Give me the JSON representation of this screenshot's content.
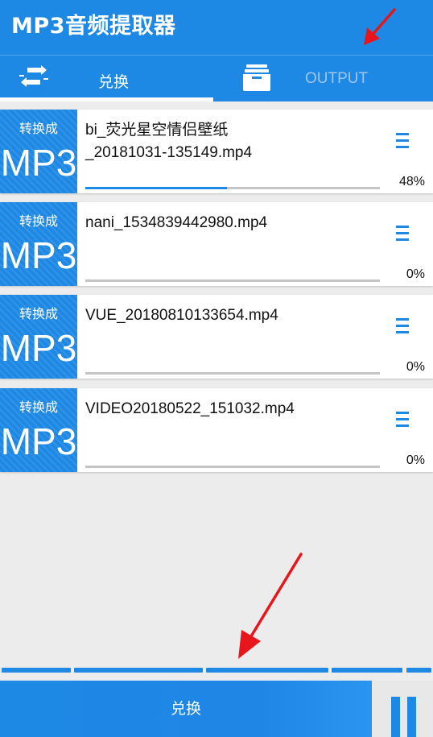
{
  "app": {
    "title": "MP3音频提取器"
  },
  "tabs": [
    {
      "label": "兑换",
      "icon": "swap-arrows-icon",
      "active": true
    },
    {
      "label": "OUTPUT",
      "icon": "stacked-folders-icon",
      "active": false
    }
  ],
  "items": [
    {
      "badge_top": "转换成",
      "badge_format": "MP3",
      "filename": "bi_荧光星空情侣壁纸\n_20181031-135149.mp4",
      "progress": 0.48,
      "percent": "48%"
    },
    {
      "badge_top": "转换成",
      "badge_format": "MP3",
      "filename": "nani_1534839442980.mp4",
      "progress": 0.0,
      "percent": "0%"
    },
    {
      "badge_top": "转换成",
      "badge_format": "MP3",
      "filename": "VUE_20180810133654.mp4",
      "progress": 0.0,
      "percent": "0%"
    },
    {
      "badge_top": "转换成",
      "badge_format": "MP3",
      "filename": "VIDEO20180522_151032.mp4",
      "progress": 0.0,
      "percent": "0%"
    }
  ],
  "bottom": {
    "convert_label": "兑换",
    "pause_icon": "pause-icon"
  },
  "colors": {
    "primary": "#1e88e5",
    "annotation_arrow": "#e8161b"
  }
}
